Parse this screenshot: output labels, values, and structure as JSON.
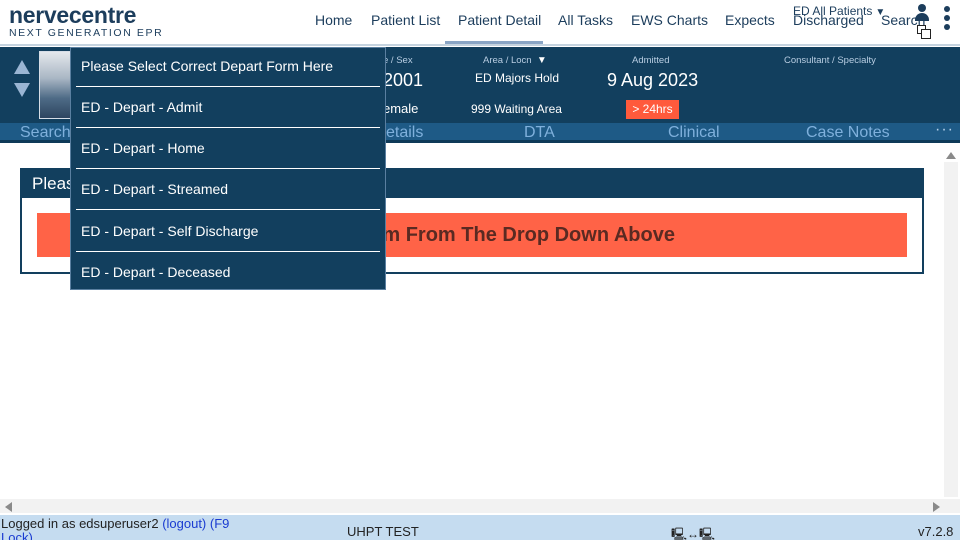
{
  "app": {
    "logo_main": "nervecentre",
    "logo_sub": "NEXT GENERATION EPR"
  },
  "nav": {
    "items": [
      "Home",
      "Patient List",
      "Patient Detail",
      "All Tasks",
      "EWS Charts",
      "Expects",
      "Discharged",
      "Search"
    ],
    "active": "Patient Detail",
    "ward_selector": "ED All Patients"
  },
  "banner": {
    "dob_label": "e / Sex",
    "dob_value": "2001",
    "sex_value": "emale",
    "area_label": "Area / Locn",
    "area_value": "ED Majors Hold",
    "locn_value": "999 Waiting Area",
    "admitted_label": "Admitted",
    "admitted_value": "9 Aug 2023",
    "wait_badge": "> 24hrs",
    "consultant_label": "Consultant / Specialty"
  },
  "tabs": [
    "Search",
    "etails",
    "DTA",
    "Clinical",
    "Case Notes"
  ],
  "tabs_more": "···",
  "panel": {
    "header": "Pleas",
    "alert": "t Depart Form From The Drop Down Above"
  },
  "dropdown": {
    "items": [
      "Please Select Correct Depart Form Here",
      "ED - Depart - Admit",
      "ED - Depart - Home",
      "ED - Depart - Streamed",
      "ED - Depart - Self Discharge",
      "ED - Depart - Deceased"
    ]
  },
  "status": {
    "logged_in": "Logged in as edsuperuser2",
    "logout": "(logout)",
    "lock": "(F9",
    "lock2": "Lock)",
    "env": "UHPT TEST",
    "network": "🖳↔🖳",
    "version": "v7.2.8"
  },
  "colors": {
    "primary": "#123f5e",
    "tab_strip": "#1e5a86",
    "alert": "#ff6347",
    "status_bar": "#c5dcf0"
  }
}
